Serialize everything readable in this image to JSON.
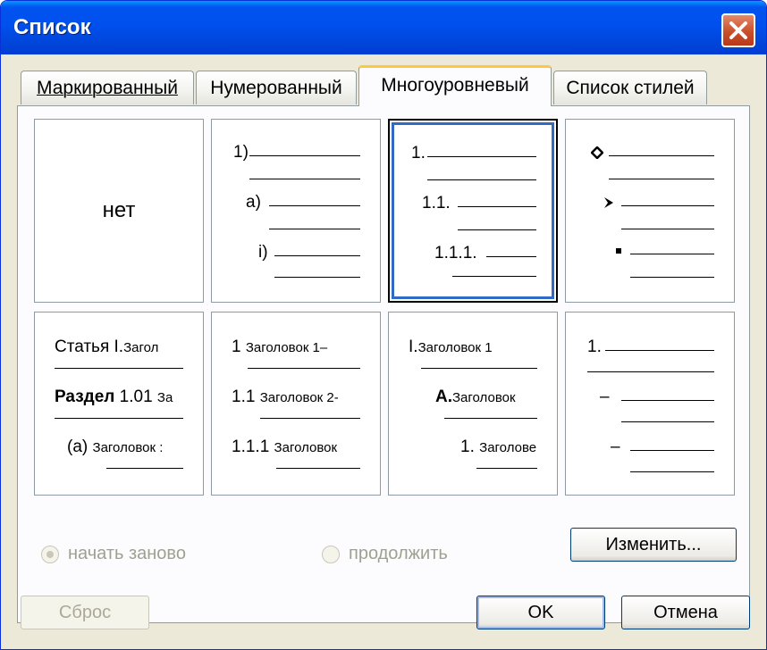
{
  "window": {
    "title": "Список"
  },
  "tabs": [
    {
      "label": "Маркированный",
      "active": false
    },
    {
      "label": "Нумерованный",
      "active": false
    },
    {
      "label": "Многоуровневый",
      "active": true
    },
    {
      "label": "Список стилей",
      "active": false
    }
  ],
  "gallery": {
    "none_label": "нет",
    "c1": [
      "1)",
      "a)",
      "i)"
    ],
    "c2": [
      "1.",
      "1.1.",
      "1.1.1."
    ],
    "c3_symbols": [
      "diamond-bullet",
      "arrow-bullet",
      "square-bullet"
    ],
    "c4": [
      "Статья",
      "I.",
      "Загол",
      "Раздел",
      "1.01",
      "За",
      "(a)",
      "Заголовок :"
    ],
    "c5": [
      "1",
      "Заголовок 1–",
      "1.1",
      "Заголовок 2-",
      "1.1.1",
      "Заголовок"
    ],
    "c6": [
      "I.",
      "Заголовок 1",
      "A.",
      "Заголовок",
      "1.",
      "Заголове"
    ],
    "c7": [
      "1.",
      "–",
      "–"
    ]
  },
  "options": {
    "restart_label": "начать заново",
    "restart_selected": true,
    "continue_label": "продолжить",
    "continue_selected": false,
    "disabled": true
  },
  "buttons": {
    "modify": "Изменить...",
    "reset": "Сброс",
    "ok": "OK",
    "cancel": "Отмена"
  }
}
